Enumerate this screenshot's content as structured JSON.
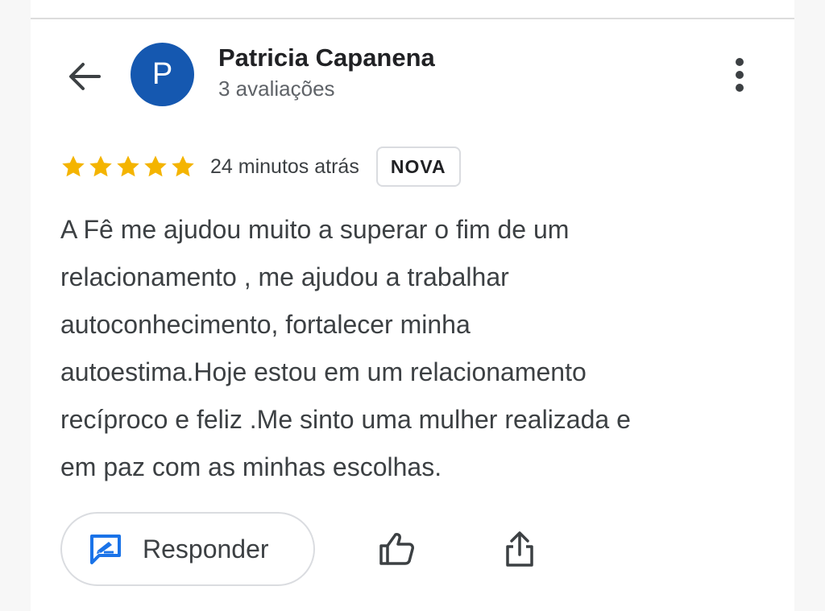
{
  "review": {
    "author": {
      "initial": "P",
      "name": "Patricia Capanena",
      "meta": "3 avaliações",
      "avatar_color": "#1558b0"
    },
    "rating": 5,
    "rating_max": 5,
    "star_color": "#f4b400",
    "time_ago": "24 minutos atrás",
    "badge": "NOVA",
    "text": "A Fê me ajudou muito a superar o fim de um\nrelacionamento , me ajudou a trabalhar\nautoconhecimento, fortalecer minha\nautoestima.Hoje estou em um relacionamento\nrecíproco e feliz .Me sinto uma mulher realizada e\nem paz com as minhas escolhas."
  },
  "actions": {
    "reply_label": "Responder",
    "reply_icon": "reply-comment-icon",
    "like_icon": "thumbs-up-icon",
    "share_icon": "share-icon",
    "accent_color": "#1a73e8"
  },
  "nav": {
    "back_icon": "arrow-left-icon",
    "more_icon": "more-vertical-icon"
  }
}
